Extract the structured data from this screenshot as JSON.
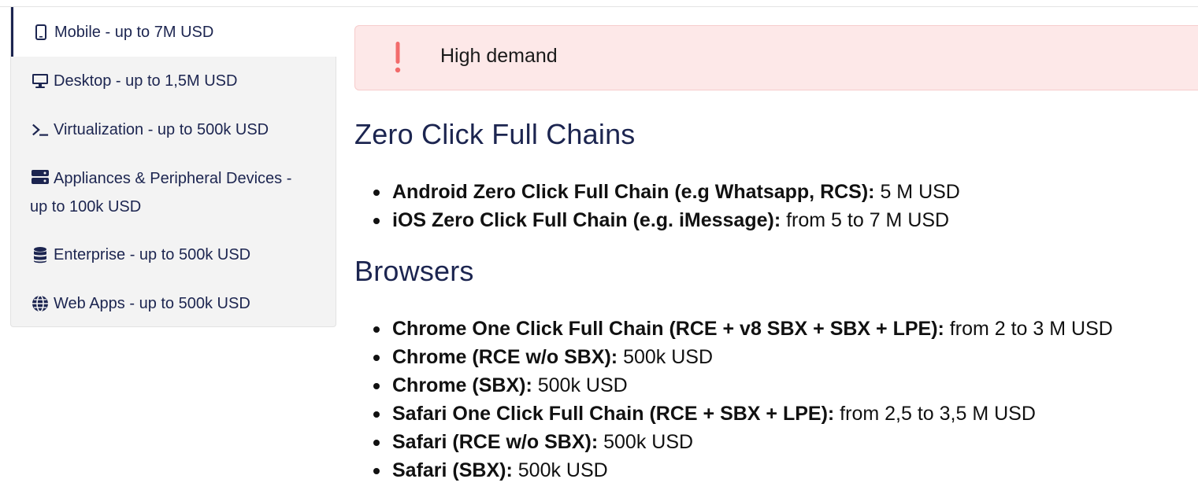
{
  "tabs": [
    {
      "label": "Mobile - up to 7M USD",
      "icon": "mobile-phone-icon",
      "active": true
    },
    {
      "label": "Desktop - up to 1,5M USD",
      "icon": "desktop-monitor-icon",
      "active": false
    },
    {
      "label": "Virtualization - up to 500k USD",
      "icon": "terminal-icon",
      "active": false
    },
    {
      "label_line1": "Appliances & Peripheral Devices -",
      "label_line2": "up to 100k USD",
      "icon": "server-icon",
      "active": false
    },
    {
      "label": "Enterprise - up to 500k USD",
      "icon": "database-icon",
      "active": false
    },
    {
      "label": "Web Apps - up to 500k USD",
      "icon": "globe-icon",
      "active": false
    }
  ],
  "alert": {
    "text": "High demand",
    "icon": "exclamation-icon",
    "color": "#f26b6b"
  },
  "sections": [
    {
      "heading": "Zero Click Full Chains",
      "items": [
        {
          "name": "Android Zero Click Full Chain (e.g Whatsapp, RCS):",
          "price": " 5 M USD"
        },
        {
          "name": "iOS Zero Click Full Chain (e.g. iMessage):",
          "price": " from 5 to 7 M USD"
        }
      ]
    },
    {
      "heading": "Browsers",
      "items": [
        {
          "name": "Chrome One Click Full Chain (RCE + v8 SBX + SBX + LPE):",
          "price": " from 2 to 3 M USD"
        },
        {
          "name": "Chrome (RCE w/o SBX):",
          "price": " 500k USD"
        },
        {
          "name": "Chrome (SBX):",
          "price": " 500k USD"
        },
        {
          "name": "Safari One Click Full Chain (RCE + SBX + LPE):",
          "price": " from 2,5 to 3,5 M USD"
        },
        {
          "name": "Safari (RCE w/o SBX):",
          "price": " 500k USD"
        },
        {
          "name": "Safari (SBX):",
          "price": " 500k USD"
        }
      ]
    }
  ],
  "colors": {
    "navy": "#1c2550",
    "alert_bg": "#fde8e8",
    "sidebar_bg": "#f3f3f3"
  }
}
